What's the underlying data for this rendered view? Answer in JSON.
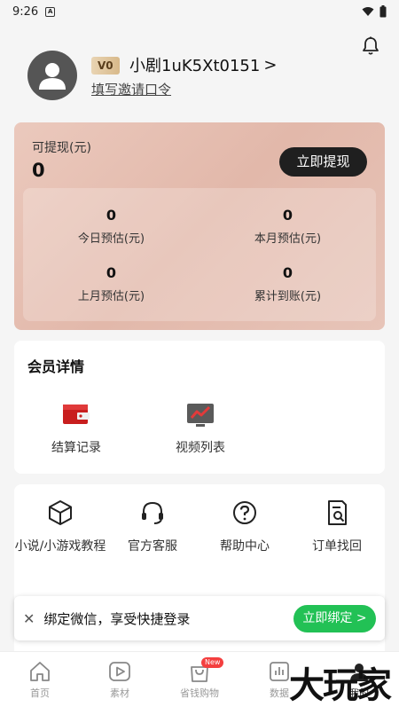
{
  "status_bar": {
    "time": "9:26",
    "app_icon": "A"
  },
  "profile": {
    "vip_level": "V0",
    "username": "小剧1uK5Xt0151",
    "username_chevron": ">",
    "invite_link": "填写邀请口令"
  },
  "earnings": {
    "withdrawable_label": "可提现(元)",
    "withdrawable_value": "0",
    "withdraw_button": "立即提现",
    "stats": [
      {
        "value": "0",
        "label": "今日预估(元)"
      },
      {
        "value": "0",
        "label": "本月预估(元)"
      },
      {
        "value": "0",
        "label": "上月预估(元)"
      },
      {
        "value": "0",
        "label": "累计到账(元)"
      }
    ]
  },
  "member": {
    "title": "会员详情",
    "items": [
      {
        "label": "结算记录",
        "icon": "settlement-record-icon"
      },
      {
        "label": "视频列表",
        "icon": "video-list-icon"
      }
    ]
  },
  "tools": [
    {
      "label": "小说/小游戏教程",
      "icon": "cube-icon"
    },
    {
      "label": "官方客服",
      "icon": "headset-icon"
    },
    {
      "label": "帮助中心",
      "icon": "help-icon"
    },
    {
      "label": "订单找回",
      "icon": "order-search-icon"
    }
  ],
  "bind_bar": {
    "close_symbol": "✕",
    "text": "绑定微信，享受快捷登录",
    "button": "立即绑定",
    "button_chevron": ">"
  },
  "tabbar": {
    "items": [
      {
        "label": "首页",
        "icon": "home-icon"
      },
      {
        "label": "素材",
        "icon": "play-icon"
      },
      {
        "label": "省钱购物",
        "icon": "shopping-bag-icon",
        "badge": "New"
      },
      {
        "label": "数据",
        "icon": "data-icon"
      },
      {
        "label": "我的",
        "icon": "profile-icon"
      }
    ]
  },
  "watermark": "大玩家",
  "colors": {
    "accent_green": "#22c155",
    "dark_button": "#1f1f1f",
    "badge_red": "#f43f3f"
  }
}
